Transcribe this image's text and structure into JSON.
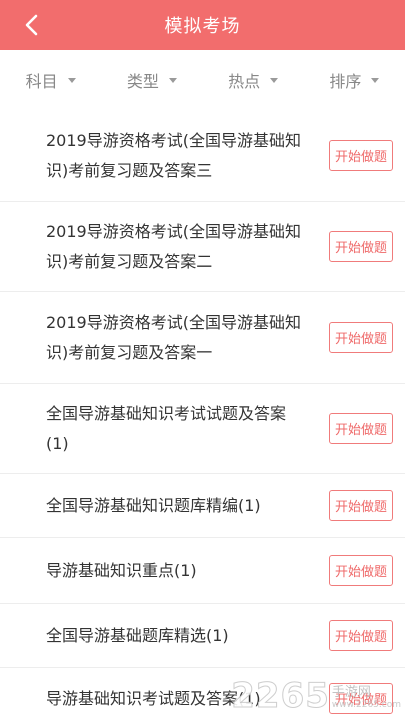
{
  "header": {
    "title": "模拟考场",
    "back_icon": "chevron-left-icon"
  },
  "filters": [
    {
      "label": "科目"
    },
    {
      "label": "类型"
    },
    {
      "label": "热点"
    },
    {
      "label": "排序"
    }
  ],
  "items": [
    {
      "title": "2019导游资格考试(全国导游基础知识)考前复习题及答案三",
      "button": "开始做题"
    },
    {
      "title": "2019导游资格考试(全国导游基础知识)考前复习题及答案二",
      "button": "开始做题"
    },
    {
      "title": "2019导游资格考试(全国导游基础知识)考前复习题及答案一",
      "button": "开始做题"
    },
    {
      "title": "全国导游基础知识考试试题及答案(1)",
      "button": "开始做题"
    },
    {
      "title": "全国导游基础知识题库精编(1)",
      "button": "开始做题"
    },
    {
      "title": "导游基础知识重点(1)",
      "button": "开始做题"
    },
    {
      "title": "全国导游基础题库精选(1)",
      "button": "开始做题"
    },
    {
      "title": "导游基础知识考试题及答案(1)",
      "button": "开始做题"
    }
  ],
  "watermark": {
    "number": "2265",
    "text": "手游网",
    "url": "www.2265.com"
  },
  "colors": {
    "accent": "#f26d6d",
    "button_border": "#f07b7b",
    "button_text": "#ef6a6a"
  }
}
